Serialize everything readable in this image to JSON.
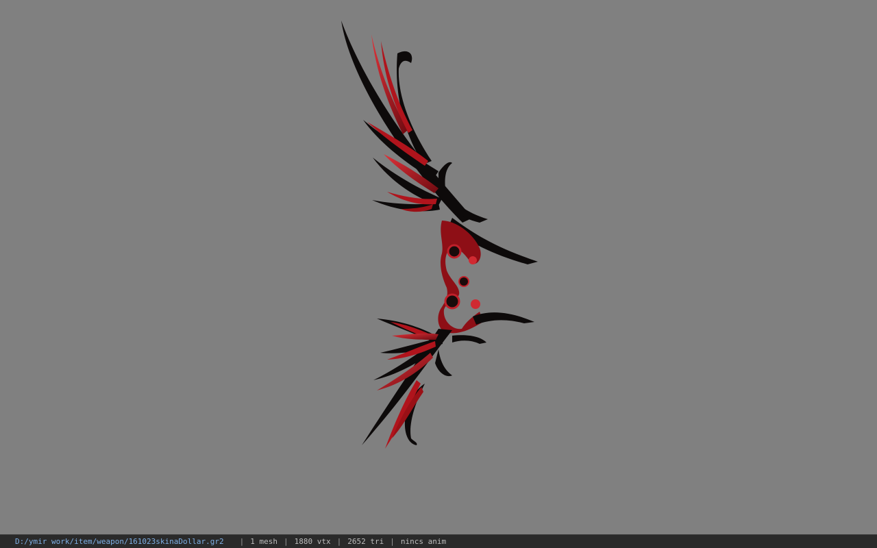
{
  "viewer": {
    "background_color": "#808080",
    "model": {
      "icon": "winged-bow-model",
      "colors": {
        "primary": "#0d0a0a",
        "accent": "#b0141c",
        "highlight": "#e0333a"
      }
    }
  },
  "status_bar": {
    "file_path": "D:/ymir work/item/weapon/161023skinaDollar.gr2",
    "separator": "|",
    "mesh_count": "1 mesh",
    "vertex_count": "1880 vtx",
    "triangle_count": "2652 tri",
    "anim_status": "nincs anim",
    "path_color": "#7fb0e6",
    "text_color": "#bdbdbd",
    "bar_color": "#2a2a2a"
  }
}
